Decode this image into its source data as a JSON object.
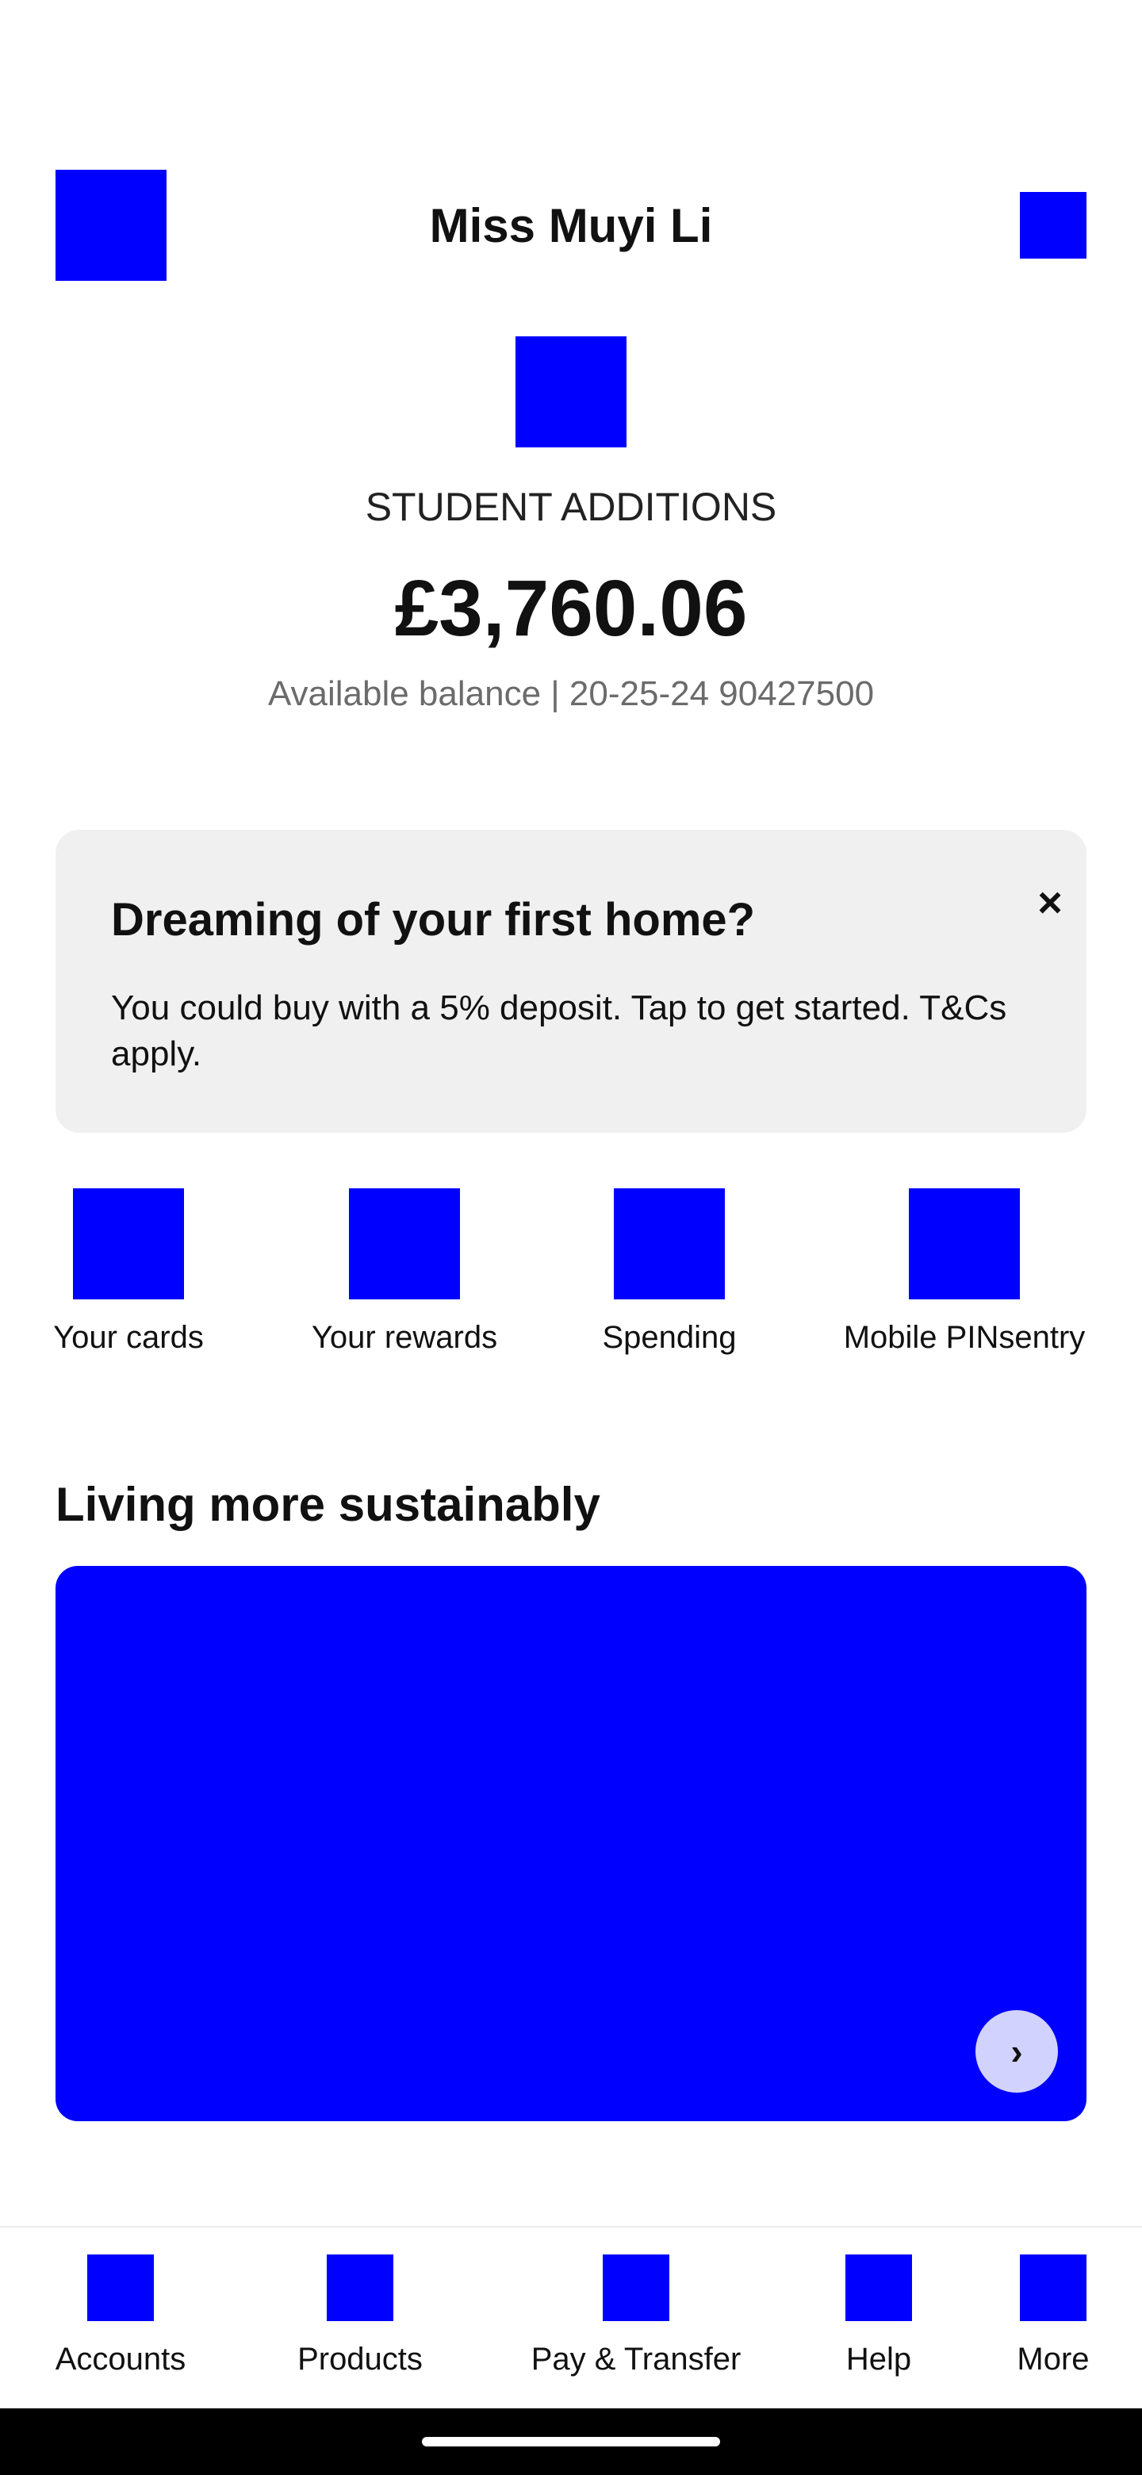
{
  "header": {
    "customer_name": "Miss Muyi Li",
    "left_icon": "menu-icon",
    "right_icon": "account-icon"
  },
  "account": {
    "icon": "account-brand-icon",
    "name": "STUDENT ADDITIONS",
    "balance": "£3,760.06",
    "meta": "Available balance | 20-25-24 90427500"
  },
  "promo": {
    "title": "Dreaming of your first home?",
    "body": "You could buy with a 5% deposit. Tap to get started. T&Cs apply.",
    "close_label": "×"
  },
  "quick_actions": [
    {
      "label": "Your cards",
      "icon": "cards-icon"
    },
    {
      "label": "Your rewards",
      "icon": "rewards-icon"
    },
    {
      "label": "Spending",
      "icon": "spending-icon"
    },
    {
      "label": "Mobile PINsentry",
      "icon": "pinsentry-icon"
    }
  ],
  "section": {
    "title": "Living more sustainably",
    "next_label": "›"
  },
  "bottom_nav": [
    {
      "label": "Accounts",
      "icon": "accounts-icon"
    },
    {
      "label": "Products",
      "icon": "products-icon"
    },
    {
      "label": "Pay & Transfer",
      "icon": "pay-transfer-icon"
    },
    {
      "label": "Help",
      "icon": "help-icon"
    },
    {
      "label": "More",
      "icon": "more-icon"
    }
  ],
  "colors": {
    "accent": "#0000ff",
    "promo_bg": "#f0f0f0",
    "muted_text": "#6b6b6b"
  }
}
